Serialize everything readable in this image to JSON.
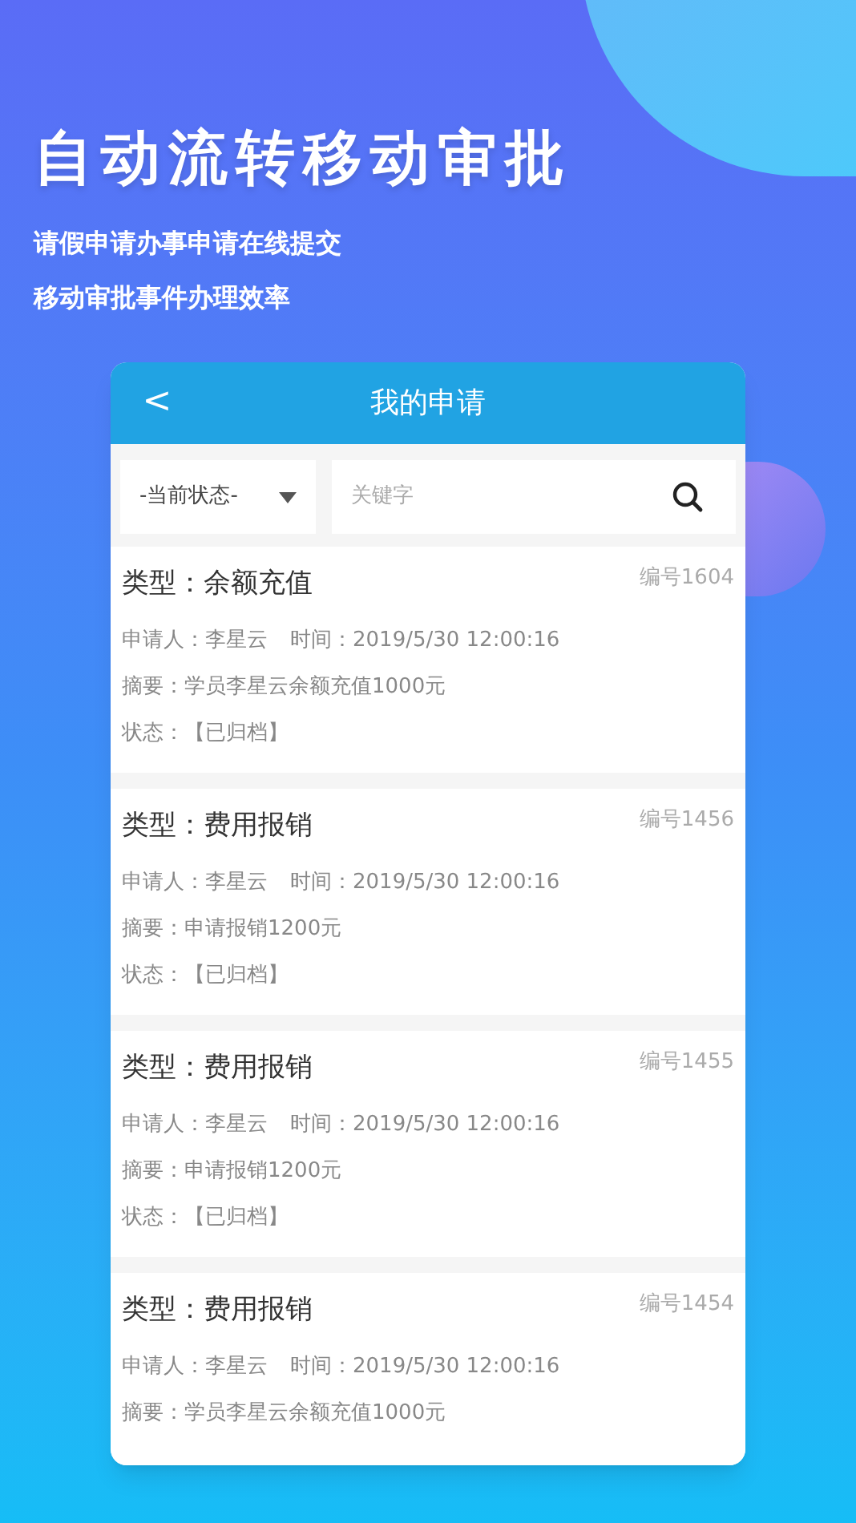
{
  "headline": "自动流转移动审批",
  "subtitles": [
    "请假申请办事申请在线提交",
    "移动审批事件办理效率"
  ],
  "screen": {
    "title": "我的申请",
    "back": "<",
    "filter": {
      "status_select": "-当前状态-",
      "search_placeholder": "关键字"
    },
    "requests": [
      {
        "type": "类型：余额充值",
        "number": "编号1604",
        "applicant": "申请人：李星云",
        "time": "时间：2019/5/30 12:00:16",
        "summary": "摘要：学员李星云余额充值1000元",
        "status": "状态：【已归档】"
      },
      {
        "type": "类型：费用报销",
        "number": "编号1456",
        "applicant": "申请人：李星云",
        "time": "时间：2019/5/30 12:00:16",
        "summary": "摘要：申请报销1200元",
        "status": "状态：【已归档】"
      },
      {
        "type": "类型：费用报销",
        "number": "编号1455",
        "applicant": "申请人：李星云",
        "time": "时间：2019/5/30 12:00:16",
        "summary": "摘要：申请报销1200元",
        "status": "状态：【已归档】"
      },
      {
        "type": "类型：费用报销",
        "number": "编号1454",
        "applicant": "申请人：李星云",
        "time": "时间：2019/5/30 12:00:16",
        "summary": "摘要：学员李星云余额充值1000元"
      }
    ]
  }
}
